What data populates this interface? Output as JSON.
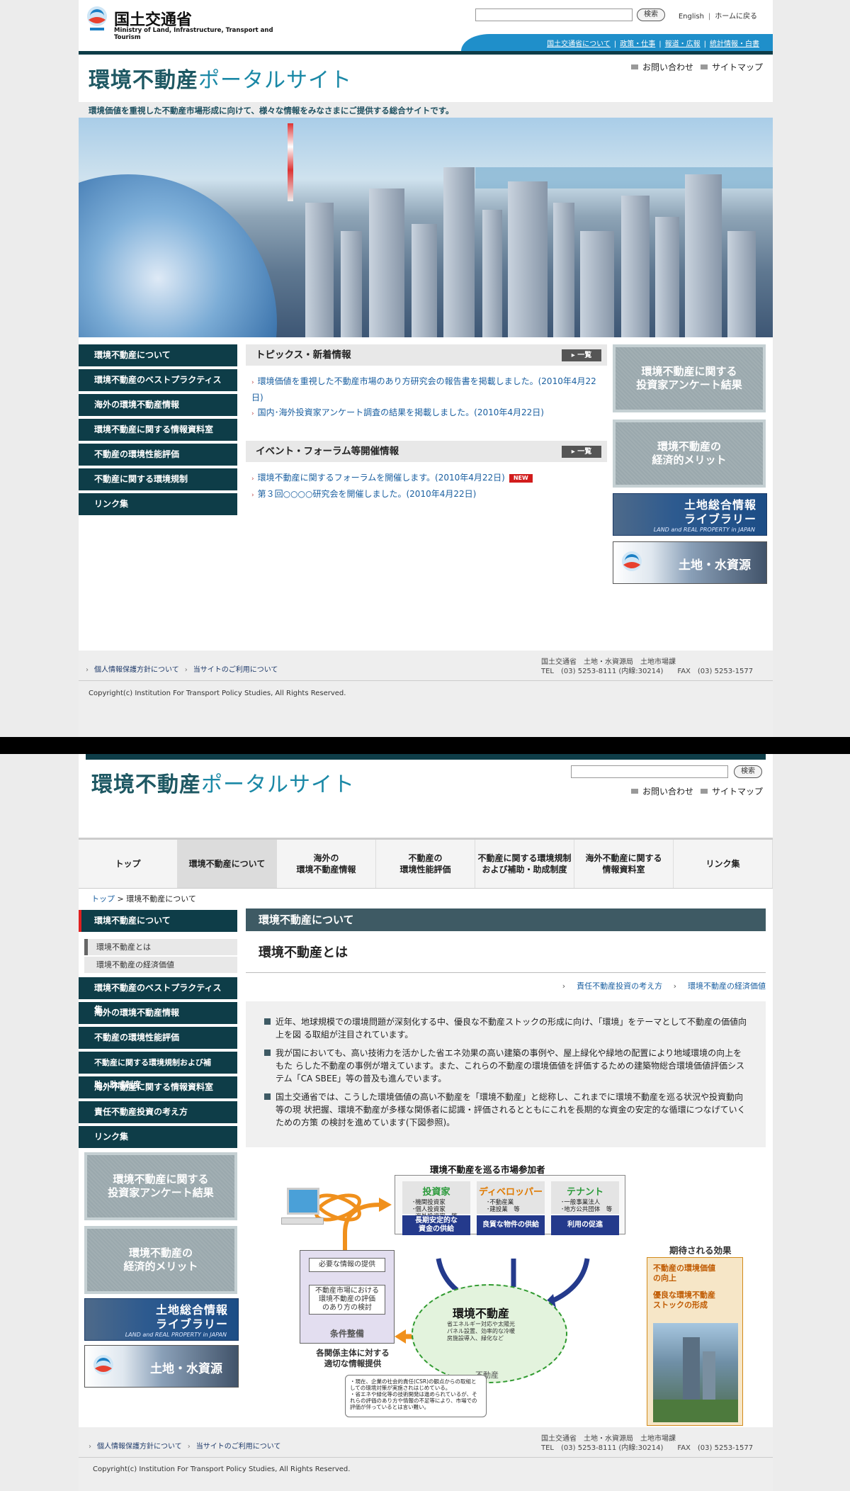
{
  "ministry": {
    "name_ja": "国土交通省",
    "name_en": "Ministry of Land, Infrastructure, Transport and Tourism"
  },
  "header": {
    "search_button": "検索",
    "english": "English",
    "home": "ホームに戻る",
    "bluebar_links": [
      "国土交通省について",
      "政策・仕事",
      "報道・広報",
      "統計情報・白書"
    ]
  },
  "site": {
    "title_a": "環境不動産",
    "title_b": "ポータルサイト",
    "contact": "お問い合わせ",
    "sitemap": "サイトマップ"
  },
  "tagline": "環境価値を重視した不動産市場形成に向けて、様々な情報をみなさまにご提供する総合サイトです。",
  "home": {
    "nav": [
      "環境不動産について",
      "環境不動産のベストプラクティス",
      "海外の環境不動産情報",
      "環境不動産に関する情報資料室",
      "不動産の環境性能評価",
      "不動産に関する環境規制",
      "リンク集"
    ],
    "topics_title": "トピックス・新着情報",
    "list_all": "一覧",
    "topics": [
      "環境価値を重視した不動産市場のあり方研究会の報告書を掲載しました。(2010年4月22日)",
      "国内･海外投資家アンケート調査の結果を掲載しました。(2010年4月22日)"
    ],
    "events_title": "イベント・フォーラム等開催情報",
    "events": [
      "環境不動産に関するフォーラムを開催します。(2010年4月22日)",
      "第３回○○○○研究会を開催しました。(2010年4月22日)"
    ],
    "new_badge": "NEW"
  },
  "banners": {
    "survey": [
      "環境不動産に関する",
      "投資家アンケート結果"
    ],
    "merit": [
      "環境不動産の",
      "経済的メリット"
    ],
    "land_lib": [
      "土地総合情報",
      "ライブラリー"
    ],
    "land_lib_en": "LAND and REAL PROPERTY in JAPAN",
    "land_water": "土地・水資源"
  },
  "footer": {
    "links": [
      "個人情報保護方針について",
      "当サイトのご利用について"
    ],
    "org": "国土交通省　土地・水資源局　土地市場課",
    "tel": "TEL　(03) 5253-8111 (内線:30214)　　FAX　(03) 5253-1577",
    "copyright": "Copyright(c) Institution For Transport Policy Studies, All Rights Reserved."
  },
  "gnav": [
    "トップ",
    "環境不動産について",
    "海外の\n環境不動産情報",
    "不動産の\n環境性能評価",
    "不動産に関する環境規制\nおよび補助・助成制度",
    "海外不動産に関する\n情報資料室",
    "リンク集"
  ],
  "breadcrumb": {
    "top": "トップ",
    "sep": ">",
    "current": "環境不動産について"
  },
  "inner": {
    "nav_current": "環境不動産について",
    "subnav": [
      "環境不動産とは",
      "環境不動産の経済価値"
    ],
    "nav": [
      "環境不動産のベストプラクティス集",
      "海外の環境不動産情報",
      "不動産の環境性能評価",
      "不動産に関する環境規制および補助・助成制度",
      "海外不動産に関する情報資料室",
      "責任不動産投資の考え方",
      "リンク集"
    ],
    "section_title": "環境不動産について",
    "page_title": "環境不動産とは",
    "related": [
      "責任不動産投資の考え方",
      "環境不動産の経済価値"
    ],
    "paragraphs": [
      "近年、地球規模での環境問題が深刻化する中、優良な不動産ストックの形成に向け、「環境」をテーマとして不動産の価値向上を図 る取組が注目されています。",
      "我が国においても、高い技術力を活かした省エネ効果の高い建築の事例や、屋上緑化や緑地の配置により地域環境の向上をもた らした不動産の事例が増えています。また、これらの不動産の環境価値を評価するための建築物総合環境価値評価システム「CA SBEE」等の普及も進んでいます。",
      "国土交通省では、こうした環境価値の高い不動産を「環境不動産」と総称し、これまでに環境不動産を巡る状況や投資動向等の現 状把握、環境不動産が多様な関係者に認識・評価されるとともにこれを長期的な資金の安定的な循環につなげていくための方策 の検討を進めています(下図参照)。"
    ]
  },
  "diagram": {
    "title": "環境不動産を巡る市場参加者",
    "players": [
      {
        "name": "投資家",
        "color": "#2a9a3a",
        "items": [
          "･機関投資家",
          "･個人投資家",
          "･海外投資家　等"
        ],
        "role": "長期安定的な\n資金の供給"
      },
      {
        "name": "ディベロッパー",
        "color": "#e07a00",
        "items": [
          "･不動産業",
          "･建設業　等"
        ],
        "role": "良質な物件の供給"
      },
      {
        "name": "テナント",
        "color": "#2a9a3a",
        "items": [
          "･一般事業法人",
          "･地方公共団体　等"
        ],
        "role": "利用の促進"
      }
    ],
    "cond_info": "必要な情報の提供",
    "cond_eval": "不動産市場における\n環境不動産の評価\nのあり方の検討",
    "cond_label": "条件整備",
    "center_title": "環境不動産",
    "center_sub": "省エネルギー対応や太陽光\nパネル設置、効率的な冷暖\n房施設導入、緑化など",
    "center_base": "不動産",
    "info_caption": "各関係主体に対する\n適切な情報提供",
    "note": [
      "・現在、企業の社会的責任(CSR)の観点からの取組としての環境対策が実施されはじめている。",
      "・省エネや緑化等の技術開発は進められているが、それらの評価のあり方や情報の不足等により、市場での評価が伴っているとは言い難い。"
    ],
    "effects_title": "期待される効果",
    "effects": [
      "不動産の環境価値\nの向上",
      "優良な環境不動産\nストックの形成"
    ]
  },
  "colors": {
    "dark_teal": "#0e3d48",
    "blue": "#1f8fca",
    "accent_red": "#e02020"
  }
}
